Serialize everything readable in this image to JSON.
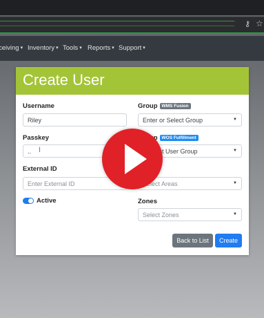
{
  "browser": {
    "icons": [
      "key-icon",
      "star-icon"
    ]
  },
  "navbar": {
    "items": [
      {
        "label": "ceiving"
      },
      {
        "label": "Inventory"
      },
      {
        "label": "Tools"
      },
      {
        "label": "Reports"
      },
      {
        "label": "Support"
      }
    ],
    "caret": "▾"
  },
  "card": {
    "title": "Create User",
    "header_color": "#a4c437"
  },
  "form": {
    "username": {
      "label": "Username",
      "value": "Riley"
    },
    "passkey": {
      "label": "Passkey",
      "value": ".."
    },
    "external_id": {
      "label": "External ID",
      "placeholder": "Enter External ID"
    },
    "active": {
      "label": "Active",
      "checked": true
    },
    "group": {
      "label": "Group",
      "badge": "WMS Fusion",
      "placeholder": "Enter or Select Group"
    },
    "user_group": {
      "label": "Group",
      "badge": "WOS Fulfillment",
      "placeholder": "Select User Group",
      "placeholder_visible": "r Select User Group"
    },
    "areas": {
      "placeholder_visible": "Select Areas"
    },
    "zones": {
      "label": "Zones",
      "placeholder": "Select Zones"
    }
  },
  "actions": {
    "back": "Back to List",
    "create": "Create"
  },
  "overlay": {
    "icon": "play-icon",
    "color": "#e02128"
  },
  "colors": {
    "primary": "#1f7cf2",
    "secondary": "#6c757d",
    "navbar": "#343a40"
  }
}
